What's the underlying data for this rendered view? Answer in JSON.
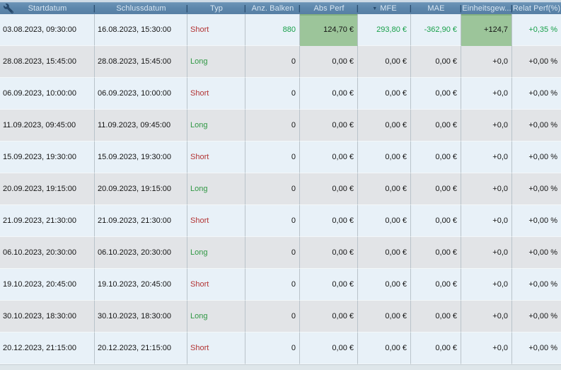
{
  "table": {
    "header_separator": "|",
    "sort_icon_glyph": "▼",
    "columns": [
      {
        "label": "Startdatum"
      },
      {
        "label": "Schlussdatum"
      },
      {
        "label": "Typ"
      },
      {
        "label": "Anz. Balken"
      },
      {
        "label": "Abs Perf"
      },
      {
        "label": "MFE",
        "sorted": "descending"
      },
      {
        "label": "MAE"
      },
      {
        "label": "Einheitsgew..."
      },
      {
        "label": "Relat Perf(%)"
      }
    ],
    "rows": [
      {
        "startdatum": "03.08.2023, 09:30:00",
        "schlussdatum": "16.08.2023, 15:30:00",
        "typ": "Short",
        "typ_color": "red",
        "anz_balken": "880",
        "abs_perf": "124,70 €",
        "mfe": "293,80 €",
        "mae": "-362,90 €",
        "einheitsgew": "+124,7",
        "relat_perf": "+0,35 %",
        "value_color": "green",
        "abs_perf_highlight": true,
        "einheitsgew_highlight": true
      },
      {
        "startdatum": "28.08.2023, 15:45:00",
        "schlussdatum": "28.08.2023, 15:45:00",
        "typ": "Long",
        "typ_color": "green",
        "anz_balken": "0",
        "abs_perf": "0,00 €",
        "mfe": "0,00 €",
        "mae": "0,00 €",
        "einheitsgew": "+0,0",
        "relat_perf": "+0,00 %",
        "value_color": "black",
        "abs_perf_highlight": false,
        "einheitsgew_highlight": false
      },
      {
        "startdatum": "06.09.2023, 10:00:00",
        "schlussdatum": "06.09.2023, 10:00:00",
        "typ": "Short",
        "typ_color": "red",
        "anz_balken": "0",
        "abs_perf": "0,00 €",
        "mfe": "0,00 €",
        "mae": "0,00 €",
        "einheitsgew": "+0,0",
        "relat_perf": "+0,00 %",
        "value_color": "black",
        "abs_perf_highlight": false,
        "einheitsgew_highlight": false
      },
      {
        "startdatum": "11.09.2023, 09:45:00",
        "schlussdatum": "11.09.2023, 09:45:00",
        "typ": "Long",
        "typ_color": "green",
        "anz_balken": "0",
        "abs_perf": "0,00 €",
        "mfe": "0,00 €",
        "mae": "0,00 €",
        "einheitsgew": "+0,0",
        "relat_perf": "+0,00 %",
        "value_color": "black",
        "abs_perf_highlight": false,
        "einheitsgew_highlight": false
      },
      {
        "startdatum": "15.09.2023, 19:30:00",
        "schlussdatum": "15.09.2023, 19:30:00",
        "typ": "Short",
        "typ_color": "red",
        "anz_balken": "0",
        "abs_perf": "0,00 €",
        "mfe": "0,00 €",
        "mae": "0,00 €",
        "einheitsgew": "+0,0",
        "relat_perf": "+0,00 %",
        "value_color": "black",
        "abs_perf_highlight": false,
        "einheitsgew_highlight": false
      },
      {
        "startdatum": "20.09.2023, 19:15:00",
        "schlussdatum": "20.09.2023, 19:15:00",
        "typ": "Long",
        "typ_color": "green",
        "anz_balken": "0",
        "abs_perf": "0,00 €",
        "mfe": "0,00 €",
        "mae": "0,00 €",
        "einheitsgew": "+0,0",
        "relat_perf": "+0,00 %",
        "value_color": "black",
        "abs_perf_highlight": false,
        "einheitsgew_highlight": false
      },
      {
        "startdatum": "21.09.2023, 21:30:00",
        "schlussdatum": "21.09.2023, 21:30:00",
        "typ": "Short",
        "typ_color": "red",
        "anz_balken": "0",
        "abs_perf": "0,00 €",
        "mfe": "0,00 €",
        "mae": "0,00 €",
        "einheitsgew": "+0,0",
        "relat_perf": "+0,00 %",
        "value_color": "black",
        "abs_perf_highlight": false,
        "einheitsgew_highlight": false
      },
      {
        "startdatum": "06.10.2023, 20:30:00",
        "schlussdatum": "06.10.2023, 20:30:00",
        "typ": "Long",
        "typ_color": "green",
        "anz_balken": "0",
        "abs_perf": "0,00 €",
        "mfe": "0,00 €",
        "mae": "0,00 €",
        "einheitsgew": "+0,0",
        "relat_perf": "+0,00 %",
        "value_color": "black",
        "abs_perf_highlight": false,
        "einheitsgew_highlight": false
      },
      {
        "startdatum": "19.10.2023, 20:45:00",
        "schlussdatum": "19.10.2023, 20:45:00",
        "typ": "Short",
        "typ_color": "red",
        "anz_balken": "0",
        "abs_perf": "0,00 €",
        "mfe": "0,00 €",
        "mae": "0,00 €",
        "einheitsgew": "+0,0",
        "relat_perf": "+0,00 %",
        "value_color": "black",
        "abs_perf_highlight": false,
        "einheitsgew_highlight": false
      },
      {
        "startdatum": "30.10.2023, 18:30:00",
        "schlussdatum": "30.10.2023, 18:30:00",
        "typ": "Long",
        "typ_color": "green",
        "anz_balken": "0",
        "abs_perf": "0,00 €",
        "mfe": "0,00 €",
        "mae": "0,00 €",
        "einheitsgew": "+0,0",
        "relat_perf": "+0,00 %",
        "value_color": "black",
        "abs_perf_highlight": false,
        "einheitsgew_highlight": false
      },
      {
        "startdatum": "20.12.2023, 21:15:00",
        "schlussdatum": "20.12.2023, 21:15:00",
        "typ": "Short",
        "typ_color": "red",
        "anz_balken": "0",
        "abs_perf": "0,00 €",
        "mfe": "0,00 €",
        "mae": "0,00 €",
        "einheitsgew": "+0,0",
        "relat_perf": "+0,00 %",
        "value_color": "black",
        "abs_perf_highlight": false,
        "einheitsgew_highlight": false
      }
    ]
  },
  "icons": {
    "settings": "wrench-icon",
    "sort": "sort-descending-icon"
  },
  "colors": {
    "header_background": "#5d87ac",
    "header_text": "#d9e7f3",
    "row_light": "#e8f1f8",
    "row_gray": "#e2e4e7",
    "highlight_cell_green": "#9cc59a",
    "positive_value_green": "#18a04a",
    "short_red": "#b23333",
    "long_green": "#2f9743"
  }
}
